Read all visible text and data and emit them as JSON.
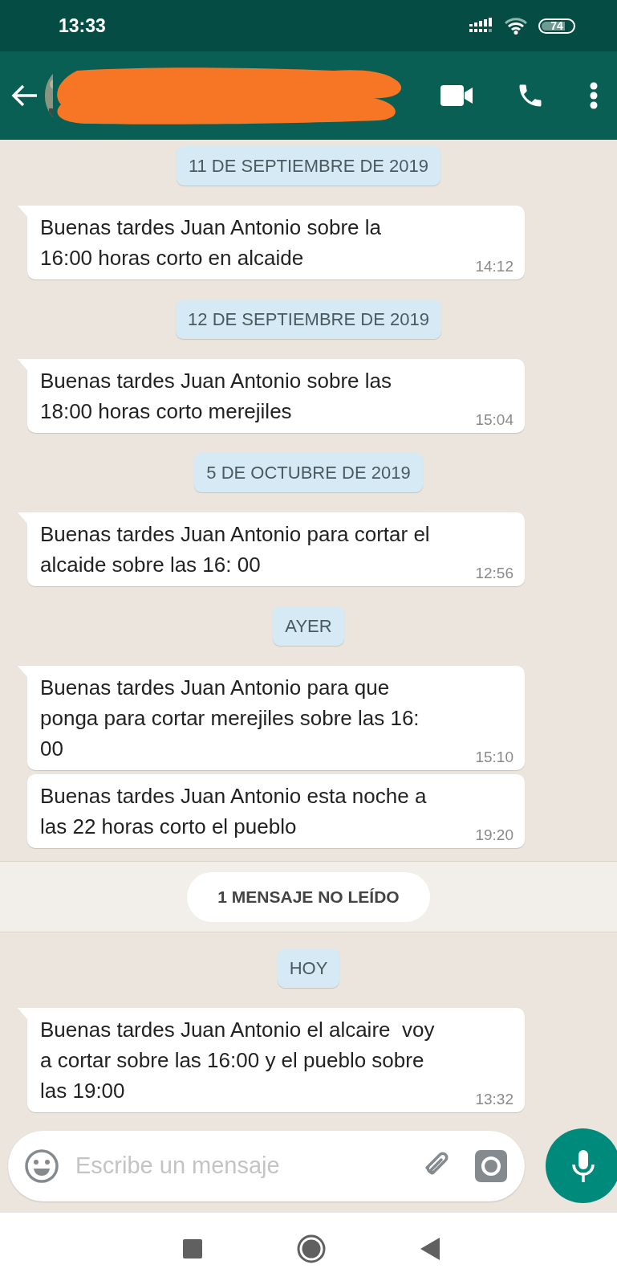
{
  "status_bar": {
    "time": "13:33",
    "battery": "74"
  },
  "chat": [
    {
      "kind": "date",
      "text": "11 DE SEPTIEMBRE DE 2019"
    },
    {
      "kind": "message",
      "tail": true,
      "text": "Buenas tardes Juan Antonio sobre la\n16:00 horas corto en alcaide",
      "time": "14:12"
    },
    {
      "kind": "date",
      "text": "12 DE SEPTIEMBRE DE 2019"
    },
    {
      "kind": "message",
      "tail": true,
      "text": "Buenas tardes Juan Antonio sobre las\n18:00 horas corto merejiles",
      "time": "15:04"
    },
    {
      "kind": "date",
      "text": "5 DE OCTUBRE DE 2019"
    },
    {
      "kind": "message",
      "tail": true,
      "text": "Buenas tardes Juan Antonio para cortar el\nalcaide sobre las 16: 00",
      "time": "12:56"
    },
    {
      "kind": "date",
      "text": "AYER"
    },
    {
      "kind": "message",
      "tail": true,
      "text": "Buenas tardes Juan Antonio para que\nponga para cortar merejiles sobre las 16:\n00",
      "time": "15:10"
    },
    {
      "kind": "message",
      "tail": false,
      "text": "Buenas tardes Juan Antonio esta noche a\nlas 22 horas corto el pueblo",
      "time": "19:20"
    },
    {
      "kind": "unread",
      "text": "1 MENSAJE NO LEÍDO"
    },
    {
      "kind": "date",
      "text": "HOY"
    },
    {
      "kind": "message",
      "tail": true,
      "text": "Buenas tardes Juan Antonio el alcaire  voy\na cortar sobre las 16:00 y el pueblo sobre\nlas 19:00",
      "time": "13:32"
    }
  ],
  "composer": {
    "placeholder": "Escribe un mensaje"
  }
}
